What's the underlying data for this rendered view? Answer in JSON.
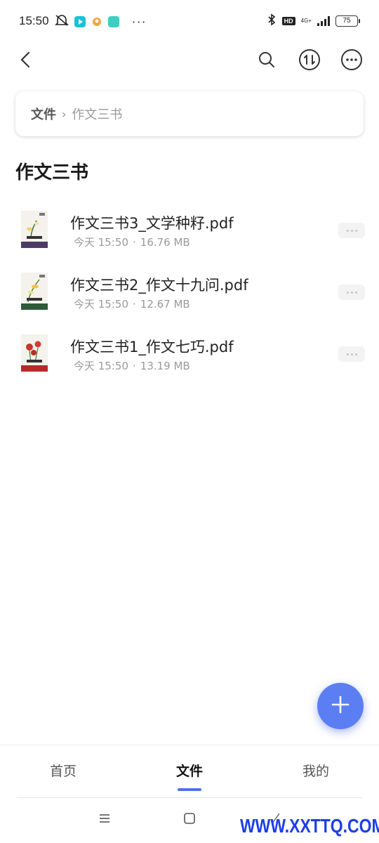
{
  "status_bar": {
    "time": "15:50",
    "network": "4G+",
    "hd": "HD",
    "battery": "75",
    "more": "···",
    "icons": [
      "mute-icon",
      "video-app-icon",
      "notification-app-icon",
      "browser-app-icon",
      "bluetooth-icon",
      "signal-icon",
      "battery-icon"
    ]
  },
  "toolbar": {
    "icons": [
      "back-icon",
      "search-icon",
      "sort-icon",
      "more-icon"
    ]
  },
  "breadcrumb": {
    "root": "文件",
    "separator": "›",
    "current": "作文三书"
  },
  "page_title": "作文三书",
  "files": [
    {
      "name": "作文三书3_文学种籽.pdf",
      "date": "今天 15:50",
      "size": "16.76 MB"
    },
    {
      "name": "作文三书2_作文十九问.pdf",
      "date": "今天 15:50",
      "size": "12.67 MB"
    },
    {
      "name": "作文三书1_作文七巧.pdf",
      "date": "今天 15:50",
      "size": "13.19 MB"
    }
  ],
  "meta_separator": "·",
  "fab": {
    "icon": "plus-icon",
    "color": "#5b7ff2"
  },
  "bottom_nav": {
    "tabs": [
      {
        "label": "首页"
      },
      {
        "label": "文件",
        "active": true
      },
      {
        "label": "我的"
      }
    ],
    "accent": "#4d72e8"
  },
  "system_nav": {
    "icons": [
      "menu-icon",
      "home-icon",
      "back-gesture-icon"
    ]
  },
  "watermark": "WWW.XXTTQ.COM"
}
